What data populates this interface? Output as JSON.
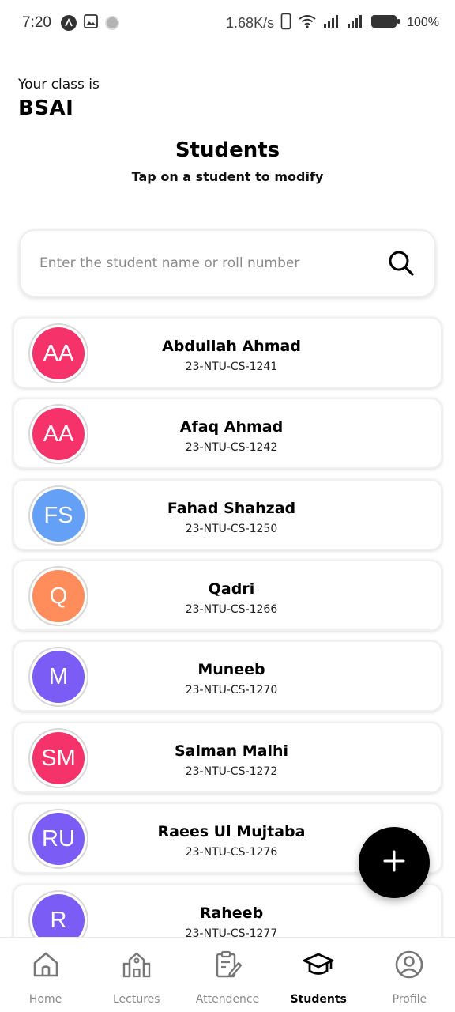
{
  "status_bar": {
    "time": "7:20",
    "network_speed": "1.68K/s",
    "battery": "100%"
  },
  "header": {
    "class_caption": "Your class is",
    "class_name": "BSAI",
    "title": "Students",
    "subtitle": "Tap on a student to modify"
  },
  "search": {
    "placeholder": "Enter the student name or roll number",
    "value": ""
  },
  "students": [
    {
      "initials": "AA",
      "name": "Abdullah Ahmad",
      "roll": "23-NTU-CS-1241",
      "color": "#f5336a"
    },
    {
      "initials": "AA",
      "name": "Afaq Ahmad",
      "roll": "23-NTU-CS-1242",
      "color": "#f5336a"
    },
    {
      "initials": "FS",
      "name": "Fahad Shahzad",
      "roll": "23-NTU-CS-1250",
      "color": "#64a0f5"
    },
    {
      "initials": "Q",
      "name": "Qadri",
      "roll": "23-NTU-CS-1266",
      "color": "#ff8c5a"
    },
    {
      "initials": "M",
      "name": "Muneeb",
      "roll": "23-NTU-CS-1270",
      "color": "#7b5cf5"
    },
    {
      "initials": "SM",
      "name": "Salman Malhi",
      "roll": "23-NTU-CS-1272",
      "color": "#f5336a"
    },
    {
      "initials": "RU",
      "name": "Raees Ul Mujtaba",
      "roll": "23-NTU-CS-1276",
      "color": "#7b5cf5"
    },
    {
      "initials": "R",
      "name": "Raheeb",
      "roll": "23-NTU-CS-1277",
      "color": "#7b5cf5"
    }
  ],
  "fab": {
    "icon": "plus-icon"
  },
  "bottom_nav": {
    "items": [
      {
        "label": "Home",
        "icon": "home-icon",
        "active": false
      },
      {
        "label": "Lectures",
        "icon": "building-icon",
        "active": false
      },
      {
        "label": "Attendence",
        "icon": "clipboard-edit-icon",
        "active": false
      },
      {
        "label": "Students",
        "icon": "graduation-cap-icon",
        "active": true
      },
      {
        "label": "Profile",
        "icon": "user-circle-icon",
        "active": false
      }
    ]
  }
}
